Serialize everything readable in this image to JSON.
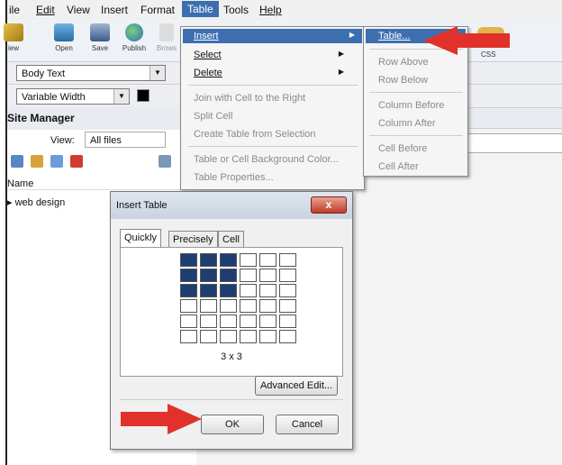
{
  "menubar": {
    "items": [
      "ile",
      "Edit",
      "View",
      "Insert",
      "Format",
      "Table",
      "Tools",
      "Help"
    ]
  },
  "toolbar": {
    "buttons": [
      "iew",
      "Open",
      "Save",
      "Publish",
      "Brows"
    ],
    "right_label": "CSS"
  },
  "format": {
    "paragraph_style": "Body Text",
    "font": "Variable Width"
  },
  "site_manager": {
    "title": "Site Manager",
    "view_label": "View:",
    "view_value": "All files",
    "column_name": "Name",
    "row": "web design"
  },
  "table_menu": {
    "insert": "Insert",
    "select": "Select",
    "delete": "Delete",
    "join": "Join with Cell to the Right",
    "split": "Split Cell",
    "create": "Create Table from Selection",
    "bgcolor": "Table or Cell Background Color...",
    "properties": "Table Properties..."
  },
  "insert_submenu": {
    "table": "Table...",
    "row_above": "Row Above",
    "row_below": "Row Below",
    "col_before": "Column Before",
    "col_after": "Column After",
    "cell_before": "Cell Before",
    "cell_after": "Cell After"
  },
  "dialog": {
    "title": "Insert Table",
    "close": "x",
    "tabs": [
      "Quickly",
      "Precisely",
      "Cell"
    ],
    "grid": {
      "rows": 6,
      "cols": 6,
      "selected_rows": 3,
      "selected_cols": 3
    },
    "grid_label": "3 x 3",
    "advanced_button": "Advanced Edit...",
    "ok_button": "OK",
    "cancel_button": "Cancel"
  },
  "colors": {
    "highlight": "#3d6fb0",
    "selected_cell": "#1e3e72",
    "arrow": "#e0312a"
  }
}
